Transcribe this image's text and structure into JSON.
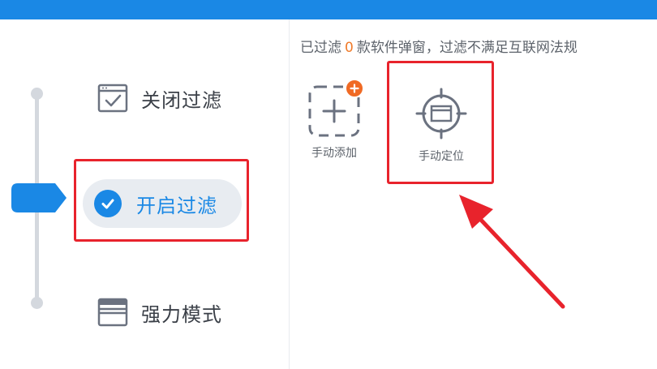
{
  "modes": {
    "items": [
      {
        "label": "关闭过滤",
        "icon": "checked-window-icon"
      },
      {
        "label": "开启过滤",
        "icon": "check-circle-icon",
        "active": true
      },
      {
        "label": "强力模式",
        "icon": "window-stack-icon"
      }
    ]
  },
  "status": {
    "prefix": "已过滤",
    "count": "0",
    "suffix": "款软件弹窗，过滤不满足互联网法规"
  },
  "tools": {
    "add_label": "手动添加",
    "add_icon": "add-dashed-icon",
    "locate_label": "手动定位",
    "locate_icon": "crosshair-window-icon"
  },
  "colors": {
    "accent": "#1a88e5",
    "highlight": "#e8232c",
    "badge": "#f06a24",
    "count": "#f07b2a"
  }
}
